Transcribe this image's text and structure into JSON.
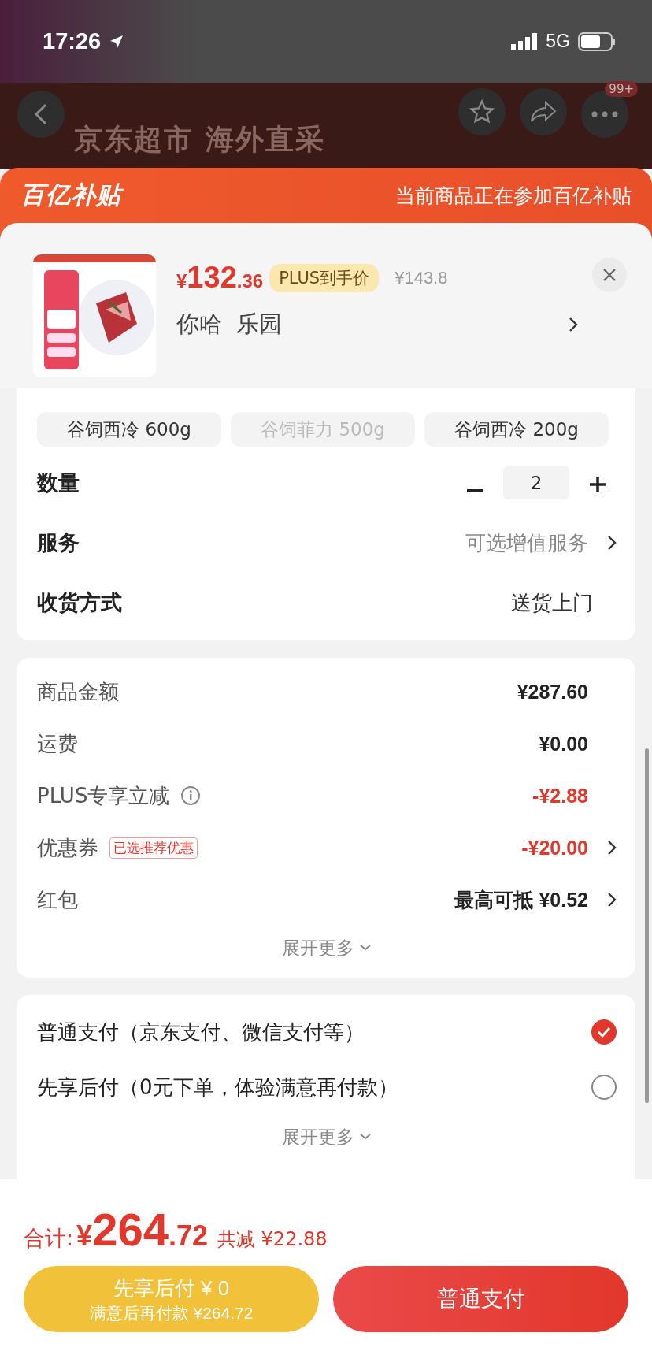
{
  "status_bar": {
    "time": "17:26",
    "network": "5G"
  },
  "nav": {
    "banner_text": "京东超市 海外直采",
    "badge": "99+"
  },
  "subsidy": {
    "logo": "百亿补贴",
    "notice": "当前商品正在参加百亿补贴"
  },
  "product": {
    "price_symbol": "¥",
    "price_int": "132",
    "price_dec": ".36",
    "price_tag": "PLUS到手价",
    "original_price": "¥143.8",
    "name": "你哈  乐园"
  },
  "specs": [
    {
      "label": "谷饲西冷 600g",
      "disabled": false
    },
    {
      "label": "谷饲菲力 500g",
      "disabled": true
    },
    {
      "label": "谷饲西冷 200g",
      "disabled": false
    }
  ],
  "options": [
    {
      "kind": "stepper",
      "label": "数量",
      "value": "2"
    },
    {
      "kind": "link",
      "label": "服务",
      "value": "可选增值服务"
    },
    {
      "kind": "text",
      "label": "收货方式",
      "value": "送货上门"
    }
  ],
  "fees": [
    {
      "label": "商品金额",
      "value": "¥287.60",
      "discount": false,
      "info": false,
      "arrow": false
    },
    {
      "label": "运费",
      "value": "¥0.00",
      "discount": false,
      "info": false,
      "arrow": false
    },
    {
      "label": "PLUS专享立减",
      "value": "-¥2.88",
      "discount": true,
      "info": true,
      "arrow": false
    },
    {
      "label": "优惠券",
      "tag": "已选推荐优惠",
      "value": "-¥20.00",
      "discount": true,
      "info": false,
      "arrow": true
    },
    {
      "label": "红包",
      "value": "最高可抵 ¥0.52",
      "discount": false,
      "info": false,
      "arrow": true
    }
  ],
  "fees_more": "展开更多",
  "payment_methods": [
    {
      "label": "普通支付（京东支付、微信支付等）",
      "selected": true
    },
    {
      "label": "先享后付（0元下单，体验满意再付款）",
      "selected": false
    }
  ],
  "payment_more": "展开更多",
  "total": {
    "label": "合计:",
    "symbol": "¥",
    "int": "264",
    "dec": ".72",
    "saving": "共减 ¥22.88"
  },
  "buttons": [
    {
      "kind": "later",
      "line1": "先享后付 ¥ 0",
      "line2": "满意后再付款 ¥264.72"
    },
    {
      "kind": "pay",
      "line1": "普通支付"
    }
  ]
}
